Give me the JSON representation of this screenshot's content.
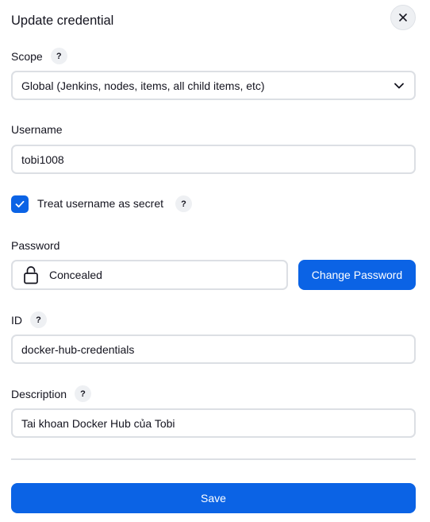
{
  "dialog": {
    "title": "Update credential",
    "close_icon": "close-icon"
  },
  "scope": {
    "label": "Scope",
    "help": "?",
    "value": "Global (Jenkins, nodes, items, all child items, etc)",
    "chevron_icon": "chevron-down-icon"
  },
  "username": {
    "label": "Username",
    "value": "tobi1008"
  },
  "secret": {
    "checked": true,
    "label": "Treat username as secret",
    "help": "?"
  },
  "password": {
    "label": "Password",
    "lock_icon": "lock-icon",
    "value": "Concealed",
    "change_label": "Change Password"
  },
  "id_field": {
    "label": "ID",
    "help": "?",
    "value": "docker-hub-credentials"
  },
  "description": {
    "label": "Description",
    "help": "?",
    "value": "Tai khoan Docker Hub của Tobi"
  },
  "actions": {
    "save_label": "Save"
  },
  "colors": {
    "accent": "#0b63e5",
    "border": "#dcdfe4",
    "help_bg": "#eef0f3"
  }
}
